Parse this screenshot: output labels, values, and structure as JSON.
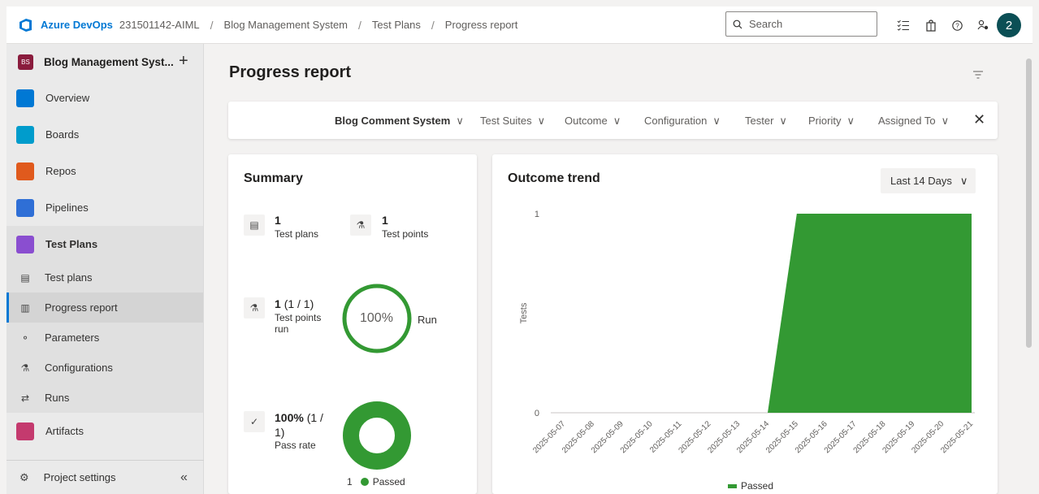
{
  "topbar": {
    "brand": "Azure DevOps",
    "org": "231501142-AIML",
    "breadcrumb": [
      "Blog Management System",
      "Test Plans",
      "Progress report"
    ],
    "search_placeholder": "Search",
    "avatar_initial": "2",
    "icons": [
      "checklist-icon",
      "shopping-bag-icon",
      "help-icon",
      "user-settings-icon"
    ]
  },
  "sidebar": {
    "project_badge": "BS",
    "project_name": "Blog Management Syst...",
    "items": [
      {
        "label": "Overview",
        "icon": "overview-icon",
        "color": "#0078d4"
      },
      {
        "label": "Boards",
        "icon": "boards-icon",
        "color": "#009ccc"
      },
      {
        "label": "Repos",
        "icon": "repos-icon",
        "color": "#e05a1d"
      },
      {
        "label": "Pipelines",
        "icon": "pipelines-icon",
        "color": "#2f6fd6"
      },
      {
        "label": "Test Plans",
        "icon": "test-plans-icon",
        "color": "#8a4ed0"
      }
    ],
    "subitems": [
      {
        "label": "Test plans",
        "icon": "test-plans-doc-icon"
      },
      {
        "label": "Progress report",
        "icon": "progress-report-icon"
      },
      {
        "label": "Parameters",
        "icon": "parameters-icon"
      },
      {
        "label": "Configurations",
        "icon": "configurations-icon"
      },
      {
        "label": "Runs",
        "icon": "runs-icon"
      }
    ],
    "artifacts": {
      "label": "Artifacts",
      "icon": "artifacts-icon",
      "color": "#c43a6e"
    },
    "settings_label": "Project settings",
    "collapse_glyph": "«"
  },
  "main": {
    "title": "Progress report",
    "filters": {
      "plan": "Blog Comment System",
      "items": [
        "Test Suites",
        "Outcome",
        "Configuration",
        "Tester",
        "Priority",
        "Assigned To"
      ]
    },
    "summary": {
      "title": "Summary",
      "test_plans_count": "1",
      "test_plans_label": "Test plans",
      "test_points_count": "1",
      "test_points_label": "Test points",
      "run_count": "1",
      "run_fraction": "(1 / 1)",
      "run_label_1": "Test points",
      "run_label_2": "run",
      "run_percent": "100%",
      "run_percent_value": 100,
      "run_word": "Run",
      "pass_percent": "100%",
      "pass_fraction_1": "(1 /",
      "pass_fraction_2": "1)",
      "pass_label": "Pass rate",
      "passed_count": "1",
      "passed_label": "Passed"
    },
    "trend": {
      "title": "Outcome trend",
      "range_label": "Last 14 Days"
    }
  },
  "colors": {
    "accent": "#0078d4",
    "passed": "#339933"
  },
  "chart_data": {
    "type": "area",
    "title": "Outcome trend",
    "ylabel": "Tests",
    "xlabel": "",
    "x": [
      "2025-05-07",
      "2025-05-08",
      "2025-05-09",
      "2025-05-10",
      "2025-05-11",
      "2025-05-12",
      "2025-05-13",
      "2025-05-14",
      "2025-05-15",
      "2025-05-16",
      "2025-05-17",
      "2025-05-18",
      "2025-05-19",
      "2025-05-20",
      "2025-05-21"
    ],
    "series": [
      {
        "name": "Passed",
        "color": "#339933",
        "values": [
          0,
          0,
          0,
          0,
          0,
          0,
          0,
          0,
          1,
          1,
          1,
          1,
          1,
          1,
          1
        ]
      }
    ],
    "yticks": [
      0,
      1
    ],
    "ylim": [
      0,
      1
    ],
    "legend": "bottom-center"
  }
}
